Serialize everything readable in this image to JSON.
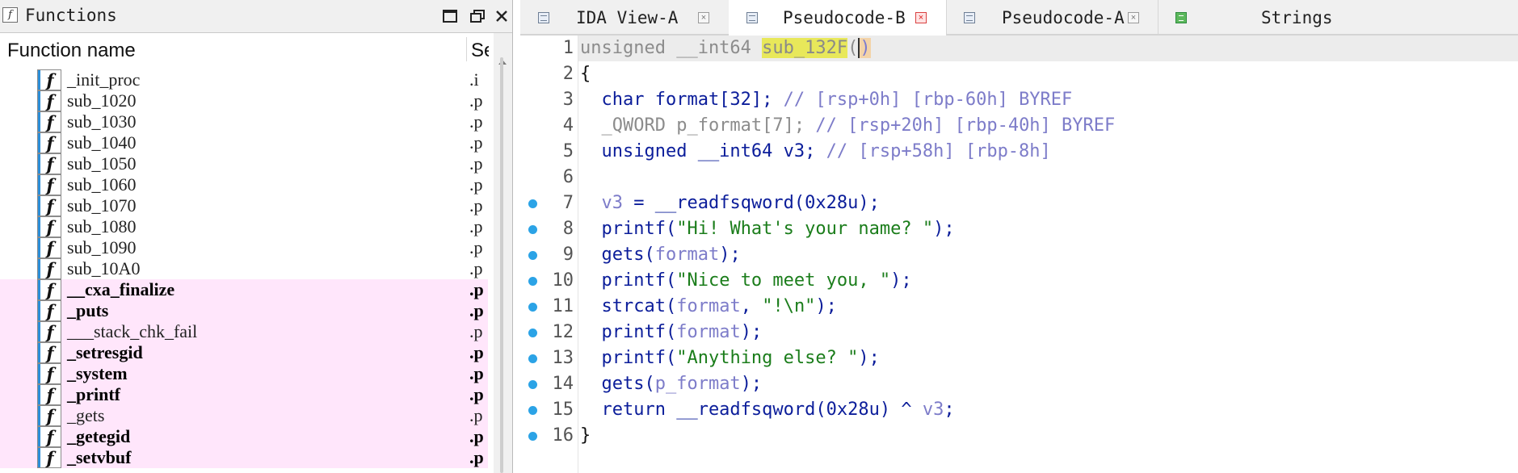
{
  "functions_pane": {
    "title": "Functions",
    "column_name": "Function name",
    "column_segment": "Se",
    "rows": [
      {
        "name": "_init_proc",
        "segment": ".i",
        "highlight": false,
        "bold": false
      },
      {
        "name": "sub_1020",
        "segment": ".p",
        "highlight": false,
        "bold": false
      },
      {
        "name": "sub_1030",
        "segment": ".p",
        "highlight": false,
        "bold": false
      },
      {
        "name": "sub_1040",
        "segment": ".p",
        "highlight": false,
        "bold": false
      },
      {
        "name": "sub_1050",
        "segment": ".p",
        "highlight": false,
        "bold": false
      },
      {
        "name": "sub_1060",
        "segment": ".p",
        "highlight": false,
        "bold": false
      },
      {
        "name": "sub_1070",
        "segment": ".p",
        "highlight": false,
        "bold": false
      },
      {
        "name": "sub_1080",
        "segment": ".p",
        "highlight": false,
        "bold": false
      },
      {
        "name": "sub_1090",
        "segment": ".p",
        "highlight": false,
        "bold": false
      },
      {
        "name": "sub_10A0",
        "segment": ".p",
        "highlight": false,
        "bold": false
      },
      {
        "name": "__cxa_finalize",
        "segment": ".p",
        "highlight": true,
        "bold": true
      },
      {
        "name": "_puts",
        "segment": ".p",
        "highlight": true,
        "bold": true
      },
      {
        "name": "___stack_chk_fail",
        "segment": ".p",
        "highlight": true,
        "bold": false
      },
      {
        "name": "_setresgid",
        "segment": ".p",
        "highlight": true,
        "bold": true
      },
      {
        "name": "_system",
        "segment": ".p",
        "highlight": true,
        "bold": true
      },
      {
        "name": "_printf",
        "segment": ".p",
        "highlight": true,
        "bold": true
      },
      {
        "name": "_gets",
        "segment": ".p",
        "highlight": true,
        "bold": false
      },
      {
        "name": "_getegid",
        "segment": ".p",
        "highlight": true,
        "bold": true
      },
      {
        "name": "_setvbuf",
        "segment": ".p",
        "highlight": true,
        "bold": true
      }
    ]
  },
  "tabs": [
    {
      "label": "IDA View-A",
      "icon": "disassembly-view-icon",
      "active": false
    },
    {
      "label": "Pseudocode-B",
      "icon": "pseudocode-icon",
      "active": true
    },
    {
      "label": "Pseudocode-A",
      "icon": "pseudocode-icon",
      "active": false
    },
    {
      "label": "Strings",
      "icon": "strings-icon",
      "active": false
    }
  ],
  "code": {
    "current_line": 1,
    "lines": [
      {
        "n": "1",
        "bp": false,
        "tokens": [
          [
            "unsigned __int64 ",
            "gray"
          ],
          [
            "sub_132F",
            "fnhl"
          ],
          [
            "(",
            "gray"
          ],
          [
            ")",
            "parenhl"
          ]
        ]
      },
      {
        "n": "2",
        "bp": false,
        "tokens": [
          [
            "{",
            "black"
          ]
        ]
      },
      {
        "n": "3",
        "bp": false,
        "tokens": [
          [
            "  char format[32]; ",
            "navy"
          ],
          [
            "// [rsp+0h] [rbp-60h] BYREF",
            "purple"
          ]
        ]
      },
      {
        "n": "4",
        "bp": false,
        "tokens": [
          [
            "  _QWORD p_format[7]; ",
            "gray"
          ],
          [
            "// [rsp+20h] [rbp-40h] BYREF",
            "purple"
          ]
        ]
      },
      {
        "n": "5",
        "bp": false,
        "tokens": [
          [
            "  unsigned __int64 v3; ",
            "navy"
          ],
          [
            "// [rsp+58h] [rbp-8h]",
            "purple"
          ]
        ]
      },
      {
        "n": "6",
        "bp": false,
        "tokens": []
      },
      {
        "n": "7",
        "bp": true,
        "tokens": [
          [
            "  ",
            "navy"
          ],
          [
            "v3",
            "purple"
          ],
          [
            " = __readfsqword(0x28u);",
            "navy"
          ]
        ]
      },
      {
        "n": "8",
        "bp": true,
        "tokens": [
          [
            "  printf(",
            "navy"
          ],
          [
            "\"Hi! What's your name? \"",
            "green"
          ],
          [
            ");",
            "navy"
          ]
        ]
      },
      {
        "n": "9",
        "bp": true,
        "tokens": [
          [
            "  gets(",
            "navy"
          ],
          [
            "format",
            "purple"
          ],
          [
            ");",
            "navy"
          ]
        ]
      },
      {
        "n": "10",
        "bp": true,
        "tokens": [
          [
            "  printf(",
            "navy"
          ],
          [
            "\"Nice to meet you, \"",
            "green"
          ],
          [
            ");",
            "navy"
          ]
        ]
      },
      {
        "n": "11",
        "bp": true,
        "tokens": [
          [
            "  strcat(",
            "navy"
          ],
          [
            "format",
            "purple"
          ],
          [
            ", ",
            "navy"
          ],
          [
            "\"!\\n\"",
            "green"
          ],
          [
            ");",
            "navy"
          ]
        ]
      },
      {
        "n": "12",
        "bp": true,
        "tokens": [
          [
            "  printf(",
            "navy"
          ],
          [
            "format",
            "purple"
          ],
          [
            ");",
            "navy"
          ]
        ]
      },
      {
        "n": "13",
        "bp": true,
        "tokens": [
          [
            "  printf(",
            "navy"
          ],
          [
            "\"Anything else? \"",
            "green"
          ],
          [
            ");",
            "navy"
          ]
        ]
      },
      {
        "n": "14",
        "bp": true,
        "tokens": [
          [
            "  gets(",
            "navy"
          ],
          [
            "p_format",
            "purple"
          ],
          [
            ");",
            "navy"
          ]
        ]
      },
      {
        "n": "15",
        "bp": true,
        "tokens": [
          [
            "  return __readfsqword(0x28u) ^ ",
            "navy"
          ],
          [
            "v3",
            "purple"
          ],
          [
            ";",
            "navy"
          ]
        ]
      },
      {
        "n": "16",
        "bp": true,
        "tokens": [
          [
            "}",
            "black"
          ]
        ]
      }
    ]
  },
  "colors": {
    "pink_row": "#ffe6fb",
    "breakpoint": "#2ba3e6",
    "keyword_navy": "#0b1d9a",
    "comment_purple": "#7d7cc9",
    "string_green": "#1b7d1b",
    "function_highlight": "#e8e85a"
  }
}
